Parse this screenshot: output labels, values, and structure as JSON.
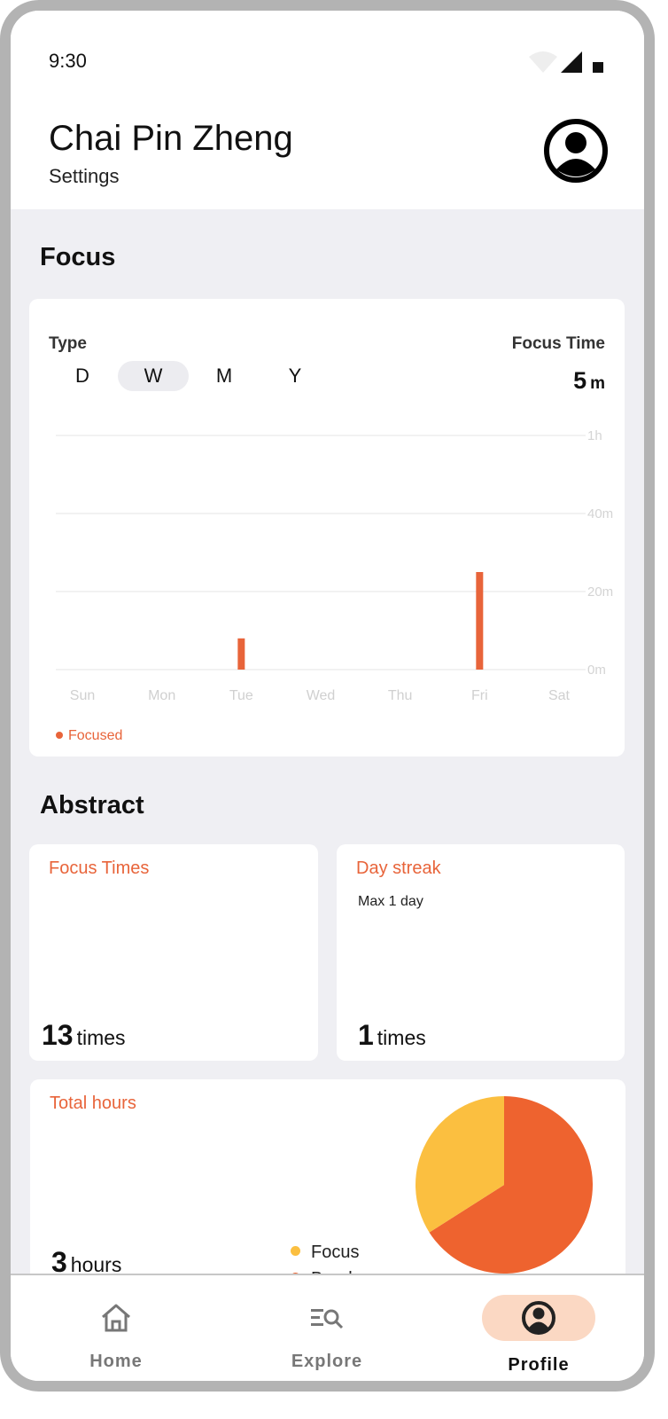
{
  "status_bar": {
    "time": "9:30"
  },
  "header": {
    "user_name": "Chai Pin Zheng",
    "subtitle": "Settings"
  },
  "focus_section": {
    "title": "Focus",
    "type_label": "Type",
    "focus_time_label": "Focus Time",
    "focus_time_value": "5",
    "focus_time_unit": "m",
    "period_tabs": [
      {
        "label": "D",
        "active": false
      },
      {
        "label": "W",
        "active": true
      },
      {
        "label": "M",
        "active": false
      },
      {
        "label": "Y",
        "active": false
      }
    ],
    "legend_label": "Focused"
  },
  "chart_data": {
    "type": "bar",
    "categories": [
      "Sun",
      "Mon",
      "Tue",
      "Wed",
      "Thu",
      "Fri",
      "Sat"
    ],
    "series": [
      {
        "name": "Focused",
        "values": [
          0,
          0,
          8,
          0,
          0,
          25,
          0
        ]
      }
    ],
    "ylim": [
      0,
      60
    ],
    "yticks": [
      0,
      20,
      40,
      60
    ],
    "ytick_labels": [
      "0m",
      "20m",
      "40m",
      "1h"
    ],
    "grid": true,
    "legend": "bottom-left",
    "bar_color": "#e8643a"
  },
  "abstract_section": {
    "title": "Abstract",
    "focus_times": {
      "title": "Focus Times",
      "value": "13",
      "unit": "times"
    },
    "day_streak": {
      "title": "Day streak",
      "subtitle": "Max 1 day",
      "value": "1",
      "unit": "times"
    },
    "total_hours": {
      "title": "Total hours",
      "value": "3",
      "unit": "hours",
      "legend": [
        {
          "label": "Focus",
          "color": "#fbbf40"
        },
        {
          "label": "Break",
          "color": "#ee632f"
        }
      ],
      "pie": [
        {
          "label": "Focus",
          "value": 34,
          "color": "#fbbf40"
        },
        {
          "label": "Break",
          "value": 66,
          "color": "#ee632f"
        }
      ]
    }
  },
  "bottom_nav": {
    "items": [
      {
        "label": "Home",
        "icon": "home-icon",
        "active": false
      },
      {
        "label": "Explore",
        "icon": "explore-search-icon",
        "active": false
      },
      {
        "label": "Profile",
        "icon": "profile-icon",
        "active": true
      }
    ]
  },
  "colors": {
    "accent": "#e8643a",
    "nav_active_bg": "#fbd8c3",
    "screen_bg": "#efeff3"
  }
}
